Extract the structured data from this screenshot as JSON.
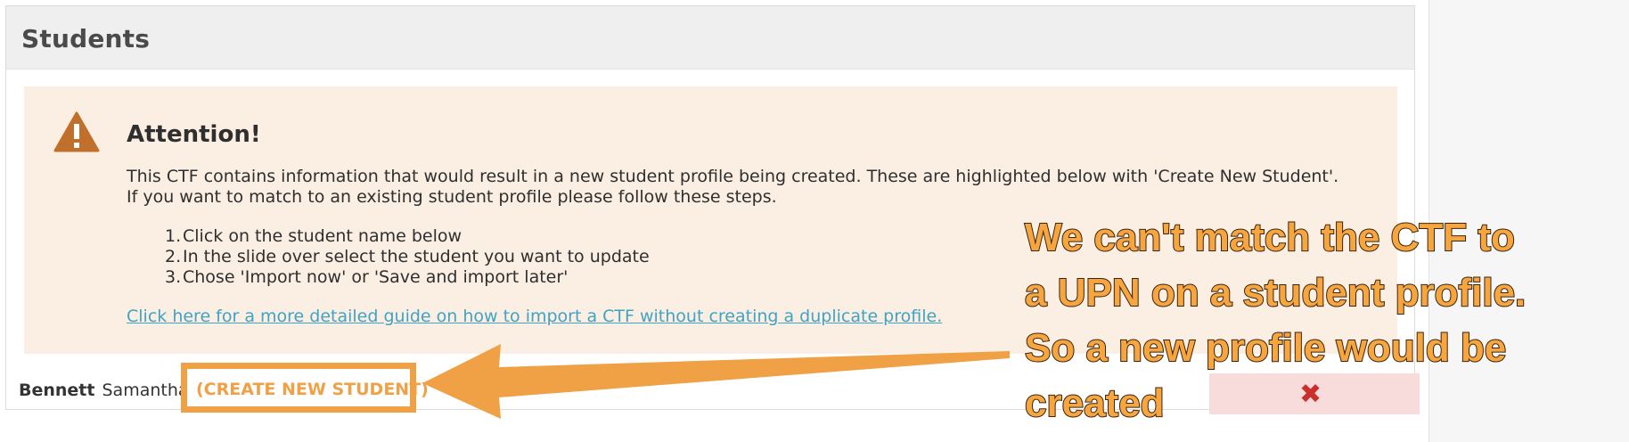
{
  "panel": {
    "title": "Students"
  },
  "alert": {
    "icon": "warning-triangle-icon",
    "heading": "Attention!",
    "text_line1": "This CTF contains information that would result in a new student profile being created. These are highlighted below with 'Create New Student'.",
    "text_line2": "If you want to match to an existing student profile please follow these steps.",
    "steps": [
      {
        "num": "1.",
        "label": "Click on the student name below"
      },
      {
        "num": "2.",
        "label": "In the slide over select the student you want to update"
      },
      {
        "num": "3.",
        "label": "Chose 'Import now' or 'Save and import later'"
      }
    ],
    "guide_link": "Click here for a more detailed guide on how to import a CTF without creating a duplicate profile."
  },
  "student": {
    "surname": "Bennett",
    "forename": "Samantha",
    "create_label": "(CREATE NEW STUDENT)",
    "remove_icon": "close-x-icon"
  },
  "annotation": {
    "lines": [
      "We can't match the CTF to",
      "a UPN on a student profile.",
      "So a new profile would be",
      "created"
    ]
  },
  "colors": {
    "alert_bg": "#fbeee2",
    "warning_icon": "#c0702a",
    "link": "#3fa3c6",
    "annotation_orange": "#f0a045",
    "remove_red": "#c9302c",
    "remove_bg": "#f8dcdc"
  }
}
